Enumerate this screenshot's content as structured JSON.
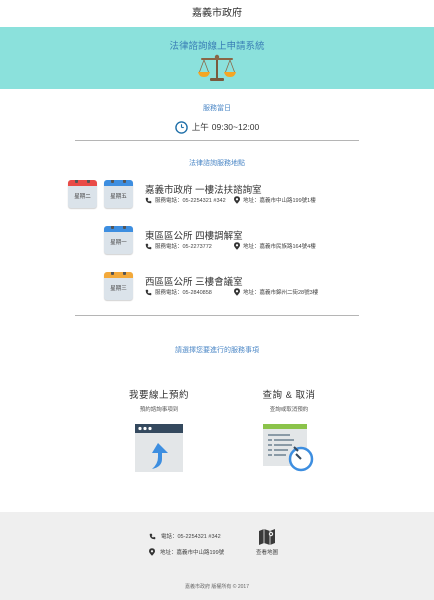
{
  "header": {
    "title": "嘉義市政府"
  },
  "hero": {
    "title": "法律諮詢線上申請系統"
  },
  "service_day": {
    "label": "服務當日",
    "time_prefix": "上午",
    "time_range": "09:30~12:00"
  },
  "locations_section": {
    "label": "法律諮詢服務地點",
    "locations": [
      {
        "days": [
          "星期二",
          "星期五"
        ],
        "name": "嘉義市政府  一樓法扶諮詢室",
        "phone": "服務電話：05-2254321 #342",
        "address": "地址：嘉義市中山路199號1樓"
      },
      {
        "days": [
          "星期一"
        ],
        "name": "東區區公所  四樓調解室",
        "phone": "服務電話：05-2273772",
        "address": "地址：嘉義市民族路164號4樓"
      },
      {
        "days": [
          "星期三"
        ],
        "name": "西區區公所  三樓會議室",
        "phone": "服務電話：05-2840858",
        "address": "地址：嘉義市錦州二街28號3樓"
      }
    ]
  },
  "choose": {
    "label": "請選擇您要進行的服務事項"
  },
  "options": {
    "book": {
      "title": "我要線上預約",
      "subtitle": "預約諮詢事項到"
    },
    "query": {
      "title": "查詢 & 取消",
      "subtitle": "查詢或取消預約"
    }
  },
  "footer": {
    "phone": "電話：05-2254321 #342",
    "address": "地址：嘉義市中山路199號",
    "map_label": "查看地圖",
    "copyright": "嘉義市政府 版權所有 © 2017"
  },
  "colors": {
    "hero_bg": "#8be1dc",
    "accent_blue": "#4b87c6",
    "calendar_red": "#e94b47",
    "calendar_blue": "#3d8ee0",
    "calendar_orange": "#f3a93a",
    "footer_bg": "#efefef"
  },
  "icons": {
    "hero": "scale-of-justice-icon",
    "hours": "clock-icon",
    "calendar": "calendar-icon",
    "phone": "phone-icon",
    "location": "location-pin-icon",
    "book": "browser-upload-icon",
    "query": "list-clock-icon",
    "map": "map-icon"
  }
}
